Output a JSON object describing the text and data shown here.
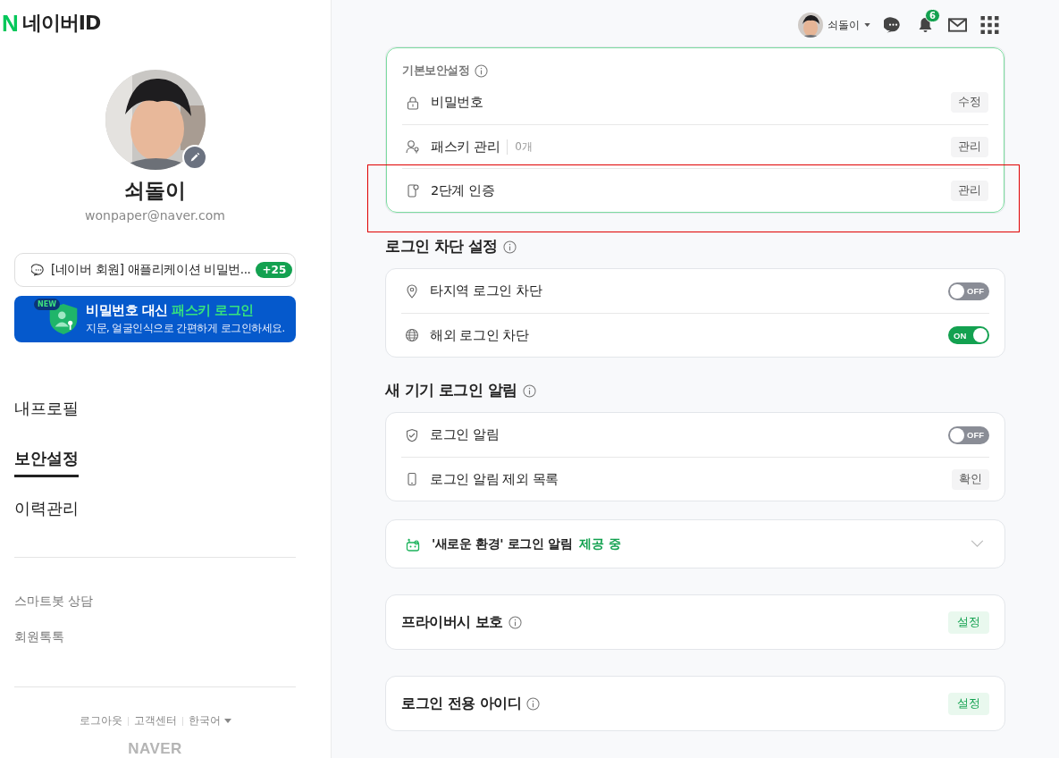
{
  "logo": {
    "mark": "N",
    "text": "네이버ID"
  },
  "profile": {
    "name": "쇠돌이",
    "email": "wonpaper@naver.com"
  },
  "notice": {
    "text": "[네이버 회원] 애플리케이션 비밀번...",
    "badge": "+25"
  },
  "banner": {
    "badge": "NEW",
    "title": "비밀번호 대신",
    "highlight": "패스키 로그인",
    "subtitle": "지문, 얼굴인식으로 간편하게 로그인하세요."
  },
  "nav": [
    {
      "label": "내프로필",
      "selected": false
    },
    {
      "label": "보안설정",
      "selected": true
    },
    {
      "label": "이력관리",
      "selected": false
    }
  ],
  "help_links": [
    "스마트봇 상담",
    "회원톡톡"
  ],
  "footer": {
    "links": [
      "로그아웃",
      "고객센터"
    ],
    "language": "한국어",
    "brand": "NAVER"
  },
  "topbar": {
    "user": "쇠돌이",
    "notification_count": "6"
  },
  "sections": [
    {
      "kind": "card",
      "title": "기본보안설정",
      "rows": [
        {
          "kind": "button",
          "label": "비밀번호",
          "action": "수정",
          "highlighted": false
        },
        {
          "kind": "button",
          "label": "패스키 관리",
          "count": "0개",
          "action": "관리",
          "highlighted": false
        },
        {
          "kind": "button",
          "label": "2단계 인증",
          "action": "관리",
          "highlighted": true
        }
      ]
    },
    {
      "kind": "group",
      "title": "로그인 차단 설정",
      "rows": [
        {
          "kind": "toggle",
          "label": "타지역 로그인 차단",
          "on": false,
          "toggle_text": "OFF"
        },
        {
          "kind": "toggle",
          "label": "해외 로그인 차단",
          "on": true,
          "toggle_text": "ON"
        }
      ]
    },
    {
      "kind": "group",
      "title": "새 기기 로그인 알림",
      "rows": [
        {
          "kind": "toggle",
          "label": "로그인 알림",
          "on": false,
          "toggle_text": "OFF"
        },
        {
          "kind": "button",
          "label": "로그인 알림 제외 목록",
          "action": "확인",
          "highlighted": false
        }
      ]
    },
    {
      "kind": "expander",
      "label": "'새로운 환경' 로그인 알림",
      "status": "제공 중",
      "expanded": false
    },
    {
      "kind": "setting",
      "title": "프라이버시 보호",
      "action": "설정"
    },
    {
      "kind": "setting",
      "title": "로그인 전용 아이디",
      "action": "설정"
    }
  ]
}
